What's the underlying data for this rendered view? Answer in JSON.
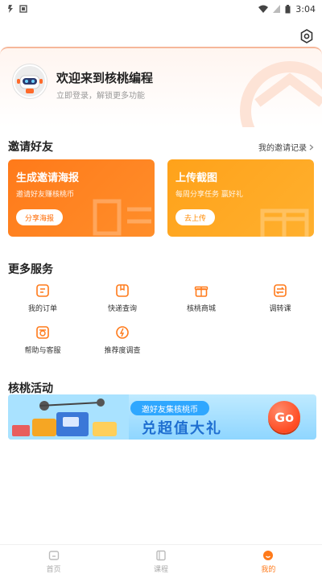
{
  "status_bar": {
    "time": "3:04"
  },
  "profile": {
    "welcome": "欢迎来到核桃编程",
    "login_tip": "立即登录，解锁更多功能"
  },
  "invite": {
    "title": "邀请好友",
    "record_link": "我的邀请记录",
    "cards": [
      {
        "title": "生成邀请海报",
        "desc": "邀请好友赚核桃币",
        "button": "分享海报"
      },
      {
        "title": "上传截图",
        "desc": "每周分享任务 赢好礼",
        "button": "去上传"
      }
    ]
  },
  "services": {
    "title": "更多服务",
    "items": [
      {
        "label": "我的订单",
        "icon": "order-icon"
      },
      {
        "label": "快递查询",
        "icon": "package-icon"
      },
      {
        "label": "核桃商城",
        "icon": "gift-icon"
      },
      {
        "label": "调转课",
        "icon": "transfer-icon"
      },
      {
        "label": "帮助与客服",
        "icon": "phone-icon"
      },
      {
        "label": "推荐度调查",
        "icon": "survey-icon"
      }
    ]
  },
  "activity": {
    "title": "核桃活动",
    "banner_pill": "邀好友集核桃币",
    "banner_text": "兑超值大礼",
    "banner_button": "Go"
  },
  "tabbar": {
    "items": [
      {
        "label": "首页",
        "icon": "home-icon"
      },
      {
        "label": "课程",
        "icon": "course-icon"
      },
      {
        "label": "我的",
        "icon": "me-icon"
      }
    ],
    "active": "我的"
  },
  "colors": {
    "accent": "#ff7a1a",
    "card_orange": "#ff7a1a",
    "card_yellow": "#ffa21a",
    "banner_blue": "#8fd6ff"
  }
}
